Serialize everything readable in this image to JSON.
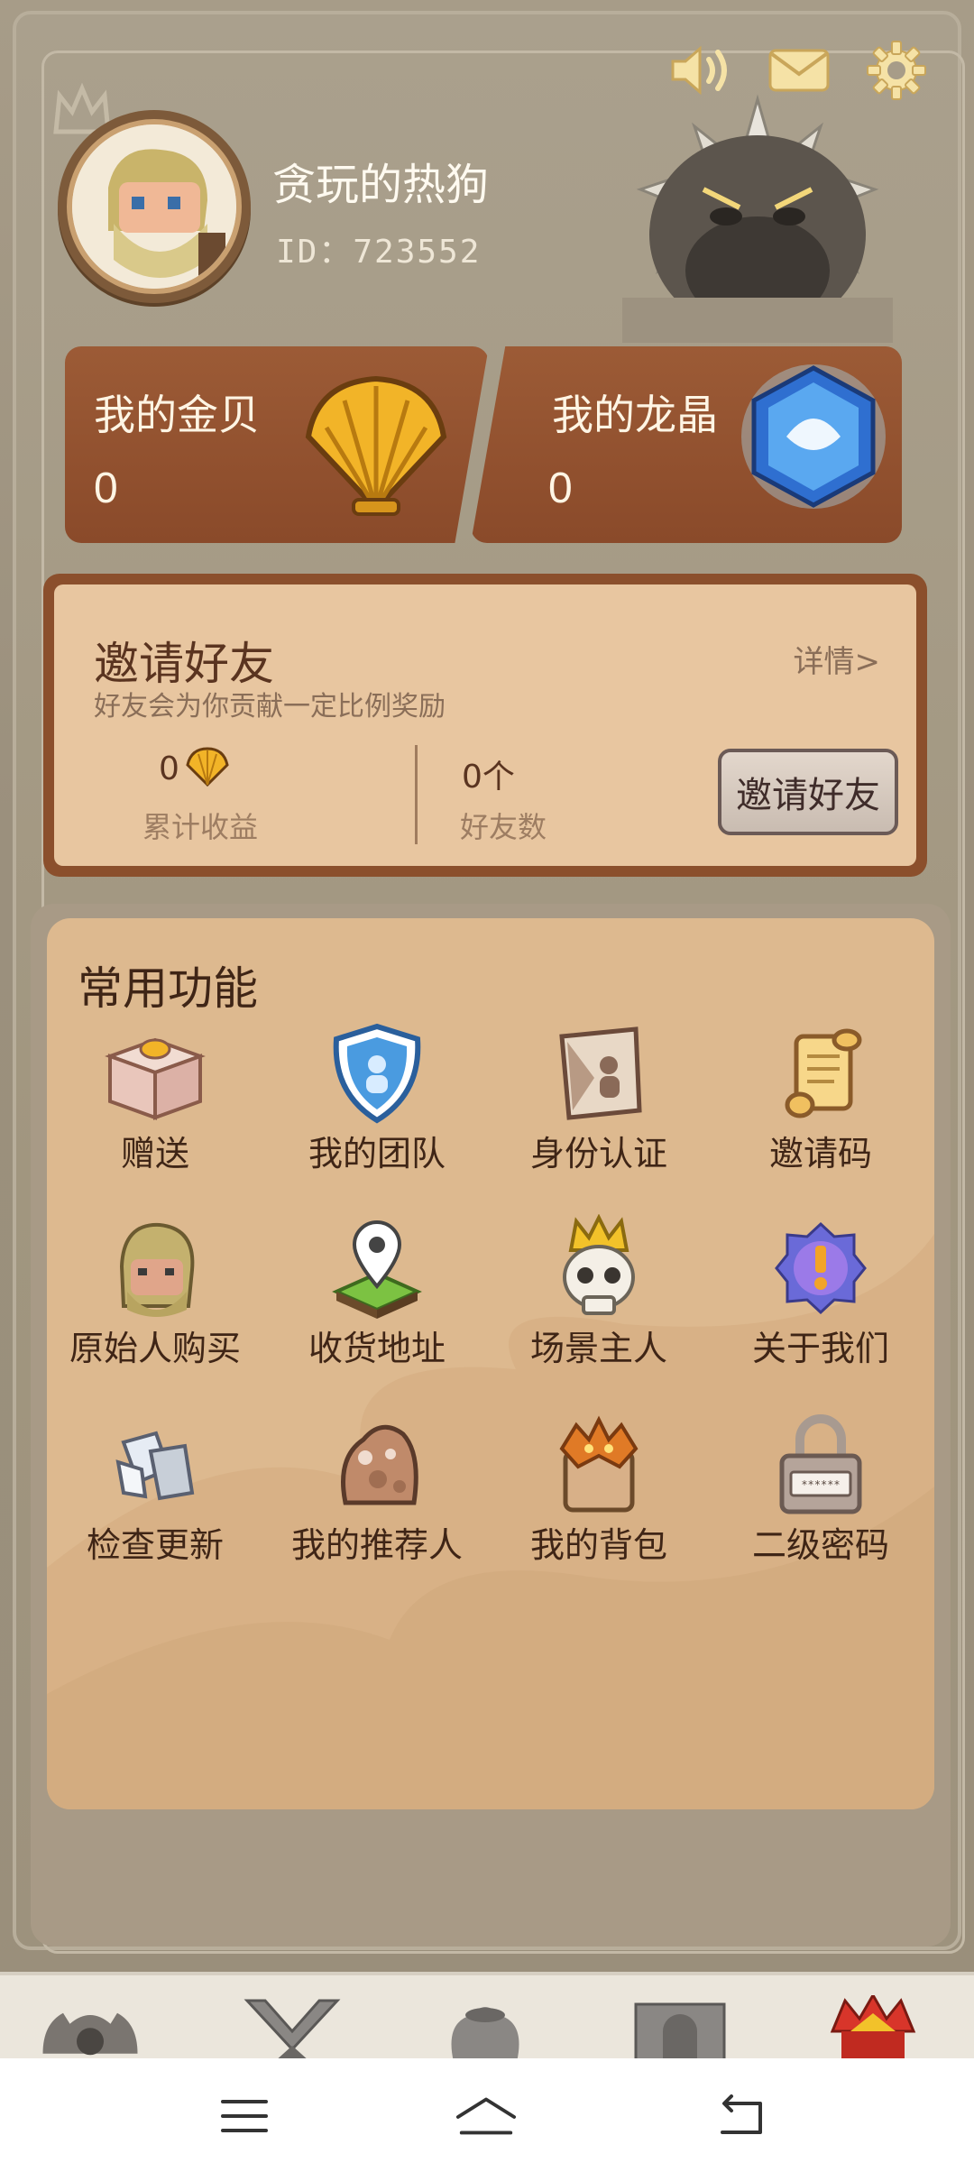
{
  "profile": {
    "username": "贪玩的热狗",
    "user_id": "ID：723552"
  },
  "currencies": [
    {
      "label": "我的金贝",
      "value": "0",
      "icon": "golden-shell-icon"
    },
    {
      "label": "我的龙晶",
      "value": "0",
      "icon": "dragon-crystal-icon"
    }
  ],
  "invite": {
    "title": "邀请好友",
    "detail_link": "详情>",
    "subtitle": "好友会为你贡献一定比例奖励",
    "earnings_value": "0",
    "earnings_label": "累计收益",
    "friends_value": "0个",
    "friends_label": "好友数",
    "button_label": "邀请好友"
  },
  "functions": {
    "title": "常用功能",
    "items": [
      {
        "label": "赠送",
        "icon": "gift-box-icon"
      },
      {
        "label": "我的团队",
        "icon": "team-shield-icon"
      },
      {
        "label": "身份认证",
        "icon": "identity-card-icon"
      },
      {
        "label": "邀请码",
        "icon": "scroll-icon"
      },
      {
        "label": "原始人购买",
        "icon": "caveman-head-icon"
      },
      {
        "label": "收货地址",
        "icon": "location-pin-icon"
      },
      {
        "label": "场景主人",
        "icon": "crowned-skull-icon"
      },
      {
        "label": "关于我们",
        "icon": "info-gem-icon"
      },
      {
        "label": "检查更新",
        "icon": "refresh-stones-icon"
      },
      {
        "label": "我的推荐人",
        "icon": "rock-creature-icon"
      },
      {
        "label": "我的背包",
        "icon": "backpack-icon"
      },
      {
        "label": "二级密码",
        "icon": "padlock-icon"
      }
    ]
  },
  "top_icons": [
    "speaker-icon",
    "mail-icon",
    "settings-gear-icon"
  ],
  "tabs": [
    "home-tab-icon",
    "battle-tab-icon",
    "bag-tab-icon",
    "gate-tab-icon",
    "profile-tab-icon"
  ],
  "colors": {
    "background": "#9d927d",
    "card_brown": "#8a4a2a",
    "panel_tan": "#ddb98f",
    "text_dark": "#3f2516"
  }
}
